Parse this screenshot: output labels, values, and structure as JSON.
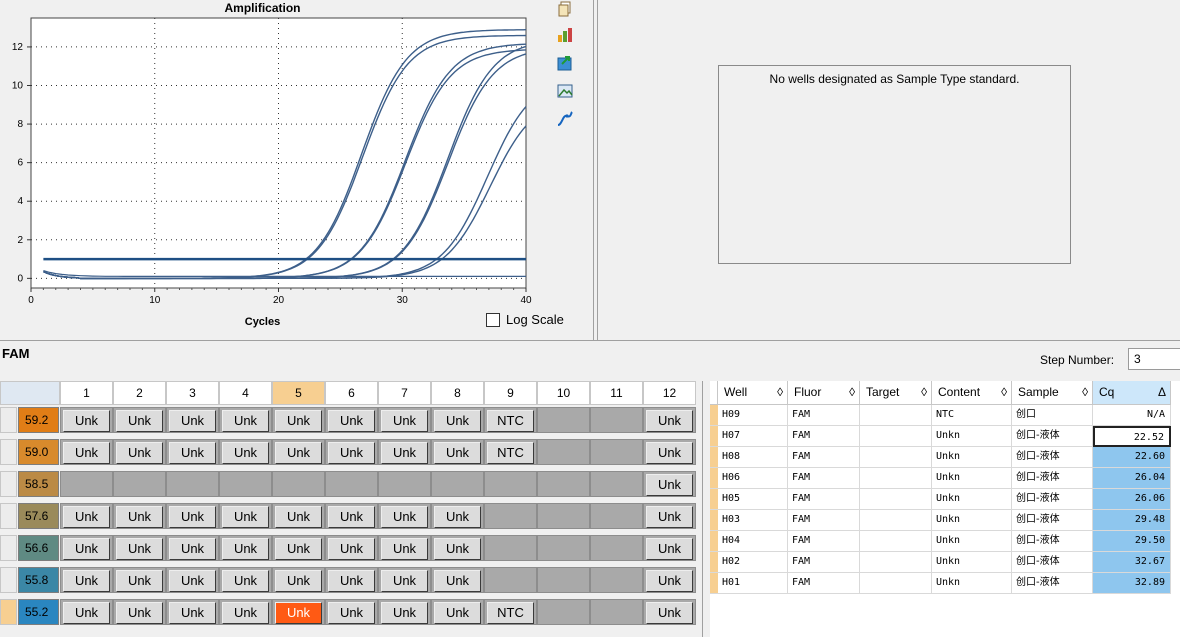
{
  "chart": {
    "title": "Amplification",
    "x_title": "Cycles",
    "log_scale_label": "Log Scale"
  },
  "chart_data": {
    "type": "line",
    "title": "Amplification",
    "xlabel": "Cycles",
    "ylabel": "",
    "xlim": [
      0,
      40
    ],
    "ylim": [
      -0.5,
      13.5
    ],
    "x_ticks": [
      0,
      10,
      20,
      30,
      40
    ],
    "y_ticks": [
      0,
      2,
      4,
      6,
      8,
      10,
      12
    ],
    "grid": true,
    "threshold": 1.0,
    "curves": [
      {
        "well": "H07",
        "cq": 22.52,
        "plateau": 12.9
      },
      {
        "well": "H08",
        "cq": 22.6,
        "plateau": 12.6
      },
      {
        "well": "H06",
        "cq": 26.04,
        "plateau": 12.2
      },
      {
        "well": "H05",
        "cq": 26.06,
        "plateau": 11.9
      },
      {
        "well": "H03",
        "cq": 29.48,
        "plateau": 12.4
      },
      {
        "well": "H04",
        "cq": 29.5,
        "plateau": 12.0
      },
      {
        "well": "H02",
        "cq": 32.67,
        "plateau": 10.5
      },
      {
        "well": "H01",
        "cq": 32.89,
        "plateau": 9.5
      }
    ]
  },
  "standard_panel": {
    "message": "No wells designated as Sample Type standard."
  },
  "toolbar_icons": [
    "copy-icon",
    "bar-chart-icon",
    "export-icon",
    "image-icon",
    "curve-icon"
  ],
  "fluor": "FAM",
  "step": {
    "label": "Step Number:",
    "value": "3"
  },
  "plate": {
    "columns": [
      "1",
      "2",
      "3",
      "4",
      "5",
      "6",
      "7",
      "8",
      "9",
      "10",
      "11",
      "12"
    ],
    "rows": [
      {
        "temp": "59.2",
        "color": "#e07d16",
        "wells": [
          "Unk",
          "Unk",
          "Unk",
          "Unk",
          "Unk",
          "Unk",
          "Unk",
          "Unk",
          "NTC",
          "",
          "",
          "Unk"
        ]
      },
      {
        "temp": "59.0",
        "color": "#d88a2c",
        "wells": [
          "Unk",
          "Unk",
          "Unk",
          "Unk",
          "Unk",
          "Unk",
          "Unk",
          "Unk",
          "NTC",
          "",
          "",
          "Unk"
        ]
      },
      {
        "temp": "58.5",
        "color": "#bb8a45",
        "wells": [
          "",
          "",
          "",
          "",
          "",
          "",
          "",
          "",
          "",
          "",
          "",
          "Unk"
        ]
      },
      {
        "temp": "57.6",
        "color": "#9a8a5a",
        "wells": [
          "Unk",
          "Unk",
          "Unk",
          "Unk",
          "Unk",
          "Unk",
          "Unk",
          "Unk",
          "",
          "",
          "",
          "Unk"
        ]
      },
      {
        "temp": "56.6",
        "color": "#5f8a83",
        "wells": [
          "Unk",
          "Unk",
          "Unk",
          "Unk",
          "Unk",
          "Unk",
          "Unk",
          "Unk",
          "",
          "",
          "",
          "Unk"
        ]
      },
      {
        "temp": "55.8",
        "color": "#3b87a6",
        "wells": [
          "Unk",
          "Unk",
          "Unk",
          "Unk",
          "Unk",
          "Unk",
          "Unk",
          "Unk",
          "",
          "",
          "",
          "Unk"
        ]
      },
      {
        "temp": "55.2",
        "color": "#2a86c0",
        "wells": [
          "Unk",
          "Unk",
          "Unk",
          "Unk",
          "Unk",
          "Unk",
          "Unk",
          "Unk",
          "NTC",
          "",
          "",
          "Unk"
        ]
      }
    ]
  },
  "table": {
    "headers": [
      "Well",
      "Fluor",
      "Target",
      "Content",
      "Sample",
      "Cq"
    ],
    "rows": [
      {
        "well": "H09",
        "fluor": "FAM",
        "target": "",
        "content": "NTC",
        "sample": "创口",
        "cq": "N/A"
      },
      {
        "well": "H07",
        "fluor": "FAM",
        "target": "",
        "content": "Unkn",
        "sample": "创口-液体",
        "cq": "22.52"
      },
      {
        "well": "H08",
        "fluor": "FAM",
        "target": "",
        "content": "Unkn",
        "sample": "创口-液体",
        "cq": "22.60"
      },
      {
        "well": "H06",
        "fluor": "FAM",
        "target": "",
        "content": "Unkn",
        "sample": "创口-液体",
        "cq": "26.04"
      },
      {
        "well": "H05",
        "fluor": "FAM",
        "target": "",
        "content": "Unkn",
        "sample": "创口-液体",
        "cq": "26.06"
      },
      {
        "well": "H03",
        "fluor": "FAM",
        "target": "",
        "content": "Unkn",
        "sample": "创口-液体",
        "cq": "29.48"
      },
      {
        "well": "H04",
        "fluor": "FAM",
        "target": "",
        "content": "Unkn",
        "sample": "创口-液体",
        "cq": "29.50"
      },
      {
        "well": "H02",
        "fluor": "FAM",
        "target": "",
        "content": "Unkn",
        "sample": "创口-液体",
        "cq": "32.67"
      },
      {
        "well": "H01",
        "fluor": "FAM",
        "target": "",
        "content": "Unkn",
        "sample": "创口-液体",
        "cq": "32.89"
      }
    ]
  }
}
